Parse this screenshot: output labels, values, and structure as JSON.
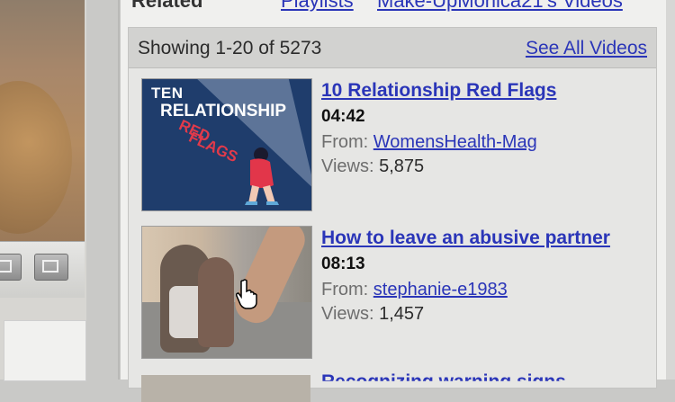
{
  "tabs": {
    "related": "Related",
    "playlists": "Playlists",
    "channel": "Make-UpMonica21's Videos"
  },
  "results": {
    "showing": "Showing 1-20 of 5273",
    "see_all": "See All Videos"
  },
  "videos": [
    {
      "title": "10 Relationship Red Flags",
      "duration": "04:42",
      "from_label": "From:",
      "from_user": "WomensHealth-Mag",
      "views_label": "Views:",
      "views": "5,875",
      "thumb_text": [
        "TEN",
        "RELATIONSHIP",
        "RED",
        "FLAGS"
      ]
    },
    {
      "title": "How to leave an abusive partner",
      "duration": "08:13",
      "from_label": "From:",
      "from_user": "stephanie-e1983",
      "views_label": "Views:",
      "views": "1,457"
    }
  ],
  "third_video": {
    "title": "Recognizing warning signs"
  },
  "colors": {
    "link": "#2a35b8",
    "thumb1_bg": "#1f3d6c",
    "thumb1_accent": "#e23a4a"
  }
}
